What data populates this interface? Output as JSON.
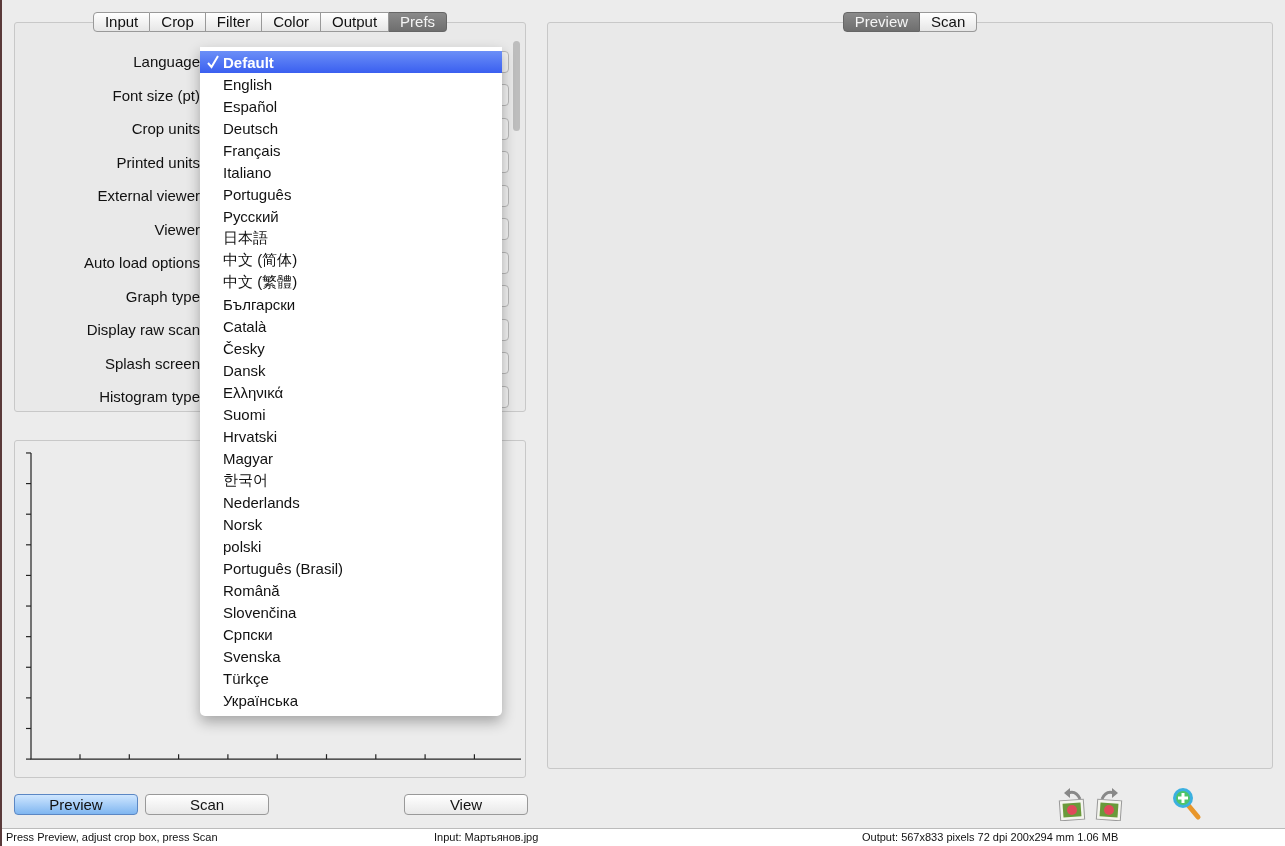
{
  "left_tabs": [
    {
      "label": "Input",
      "selected": false
    },
    {
      "label": "Crop",
      "selected": false
    },
    {
      "label": "Filter",
      "selected": false
    },
    {
      "label": "Color",
      "selected": false
    },
    {
      "label": "Output",
      "selected": false
    },
    {
      "label": "Prefs",
      "selected": true
    }
  ],
  "settings": [
    {
      "label": "Language"
    },
    {
      "label": "Font size (pt)"
    },
    {
      "label": "Crop units"
    },
    {
      "label": "Printed units"
    },
    {
      "label": "External viewer"
    },
    {
      "label": "Viewer"
    },
    {
      "label": "Auto load options"
    },
    {
      "label": "Graph type"
    },
    {
      "label": "Display raw scan"
    },
    {
      "label": "Splash screen"
    },
    {
      "label": "Histogram type"
    }
  ],
  "language_menu": {
    "items": [
      {
        "label": "Default",
        "selected": true
      },
      {
        "label": "English",
        "selected": false
      },
      {
        "label": "Español",
        "selected": false
      },
      {
        "label": "Deutsch",
        "selected": false
      },
      {
        "label": "Français",
        "selected": false
      },
      {
        "label": "Italiano",
        "selected": false
      },
      {
        "label": "Português",
        "selected": false
      },
      {
        "label": "Русский",
        "selected": false
      },
      {
        "label": "日本語",
        "selected": false
      },
      {
        "label": "中文 (简体)",
        "selected": false
      },
      {
        "label": "中文 (繁體)",
        "selected": false
      },
      {
        "label": "Български",
        "selected": false
      },
      {
        "label": "Català",
        "selected": false
      },
      {
        "label": "Česky",
        "selected": false
      },
      {
        "label": "Dansk",
        "selected": false
      },
      {
        "label": "Ελληνικά",
        "selected": false
      },
      {
        "label": "Suomi",
        "selected": false
      },
      {
        "label": "Hrvatski",
        "selected": false
      },
      {
        "label": "Magyar",
        "selected": false
      },
      {
        "label": "한국어",
        "selected": false
      },
      {
        "label": "Nederlands",
        "selected": false
      },
      {
        "label": "Norsk",
        "selected": false
      },
      {
        "label": "polski",
        "selected": false
      },
      {
        "label": "Português (Brasil)",
        "selected": false
      },
      {
        "label": "Română",
        "selected": false
      },
      {
        "label": "Slovenčina",
        "selected": false
      },
      {
        "label": "Српски",
        "selected": false
      },
      {
        "label": "Svenska",
        "selected": false
      },
      {
        "label": "Türkçe",
        "selected": false
      },
      {
        "label": "Українська",
        "selected": false
      }
    ]
  },
  "buttons": [
    {
      "label": "Preview",
      "selected": true
    },
    {
      "label": "Scan",
      "selected": false
    },
    {
      "label": "View",
      "selected": false
    }
  ],
  "right_tabs": [
    {
      "label": "Preview",
      "selected": true
    },
    {
      "label": "Scan",
      "selected": false
    }
  ],
  "status_bar": {
    "left": "Press Preview, adjust crop box, press Scan",
    "middle": "Input: Мартьянов.jpg",
    "right": "Output: 567x833 pixels 72 dpi 200x294 mm 1.06 MB"
  }
}
